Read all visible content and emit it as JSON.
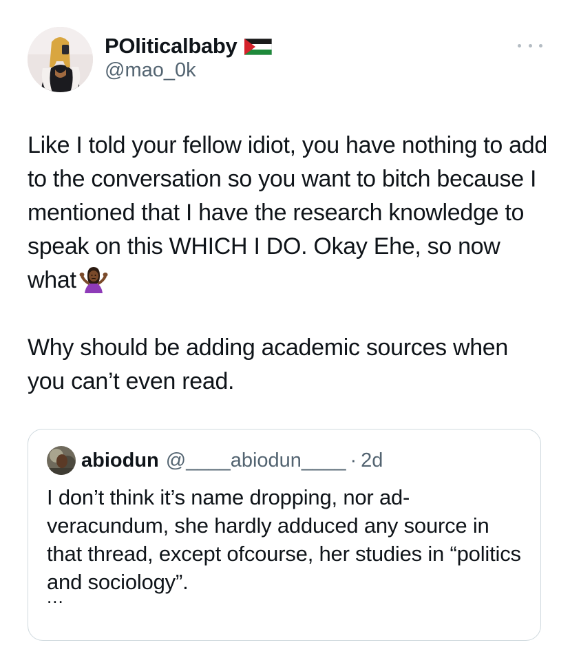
{
  "author": {
    "display_name": "POliticalbaby",
    "flag_icon": "palestine-flag-icon",
    "handle": "@mao_0k",
    "avatar_icon": "profile-photo"
  },
  "tweet": {
    "paragraph1": "Like I told your fellow idiot, you have nothing to add to the conversation so you want to bitch because I mentioned that I have the research knowledge to speak on this WHICH I DO. Okay Ehe, so now what",
    "paragraph1_emoji": "woman-shrugging-emoji",
    "paragraph2": "Why should be adding academic sources when you can’t even read."
  },
  "quoted_tweet": {
    "name": "abiodun",
    "handle": "@____abiodun____",
    "separator": "·",
    "time": "2d",
    "text": "I don’t think it’s name dropping, nor ad-veracundum, she hardly adduced any source in that thread, except ofcourse, her studies in “politics and sociology”.",
    "truncation": "..."
  },
  "menu": {
    "more_icon": "more-options-icon"
  },
  "colors": {
    "text_primary": "#0f1419",
    "text_secondary": "#536471",
    "border": "#cfd9de"
  }
}
